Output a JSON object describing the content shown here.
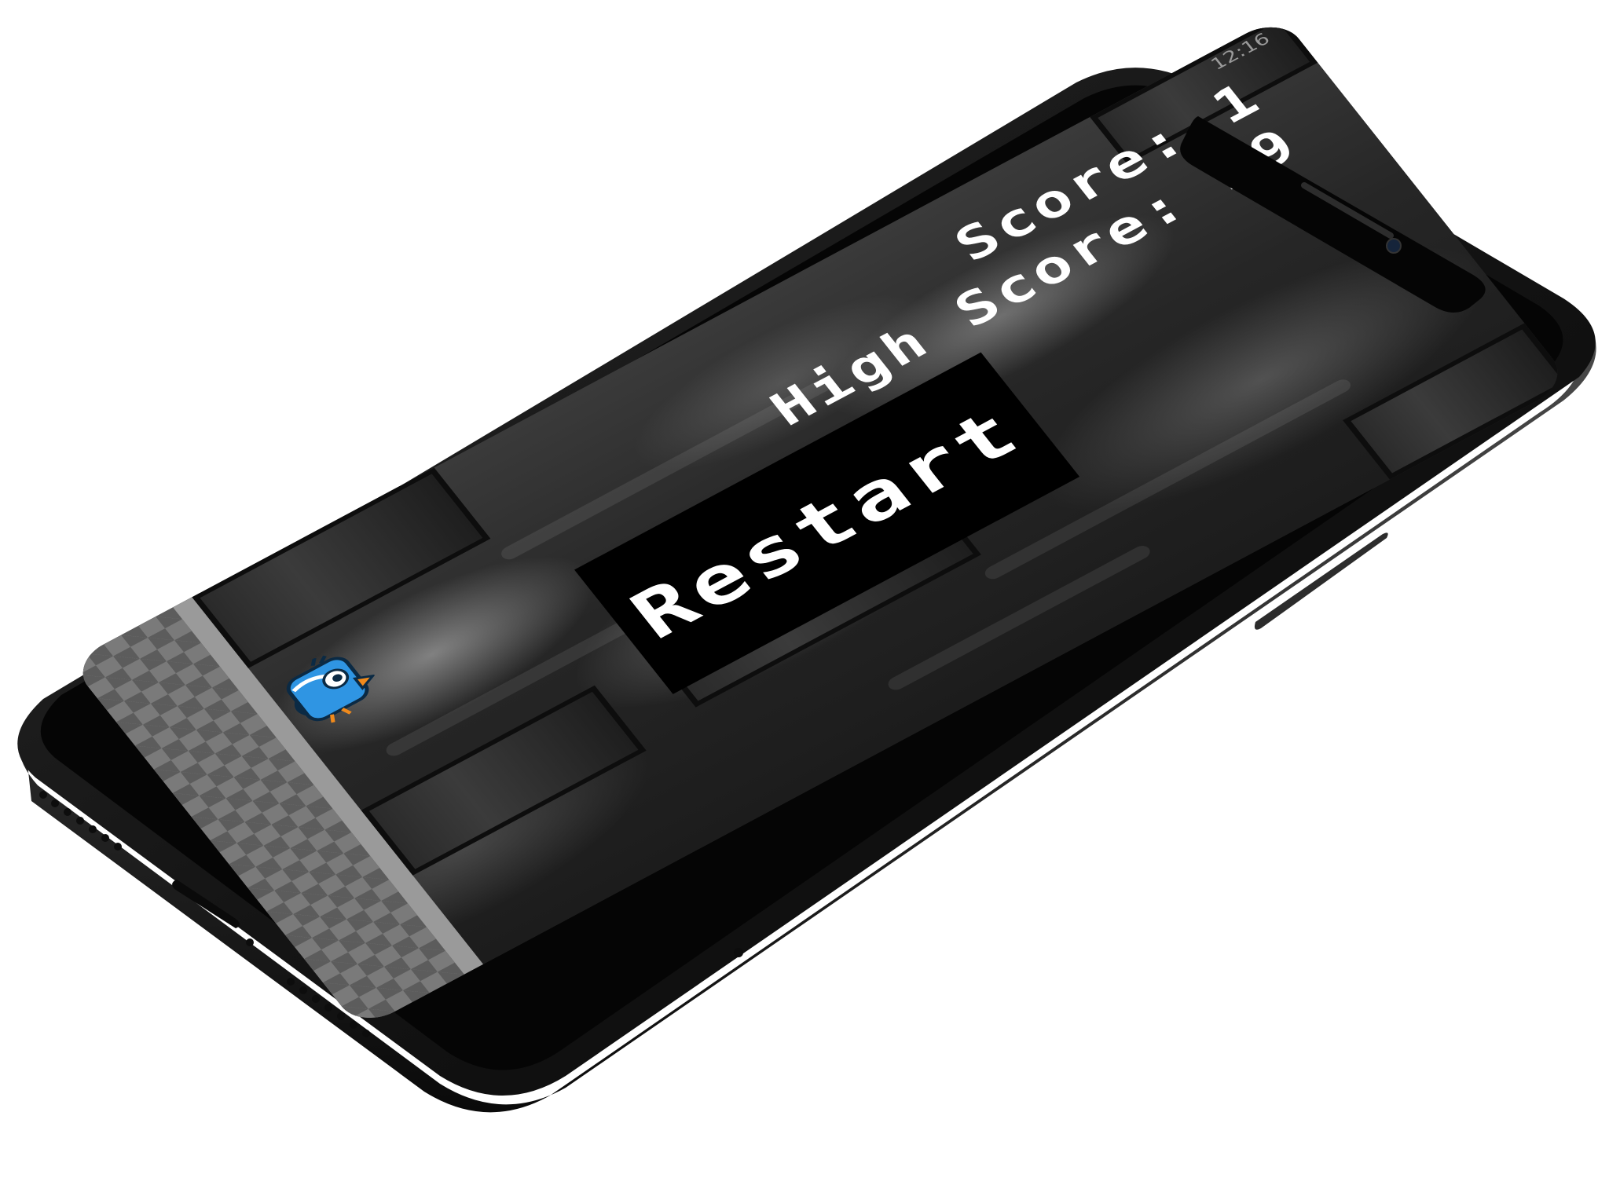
{
  "status_bar": {
    "time": "12:16"
  },
  "game": {
    "score_text": "Score: 1",
    "high_score_text": "High Score: 29",
    "score": 1,
    "high_score": 29,
    "restart_label": "Restart"
  },
  "colors": {
    "phone_body": "#1b1b1b",
    "restart_bg": "#000000",
    "text": "#ffffff",
    "bird_blue": "#2f95e3",
    "bird_beak": "#f08a1c",
    "ground": "#7a7a7a"
  },
  "icons": {
    "bird": "bird-icon"
  }
}
